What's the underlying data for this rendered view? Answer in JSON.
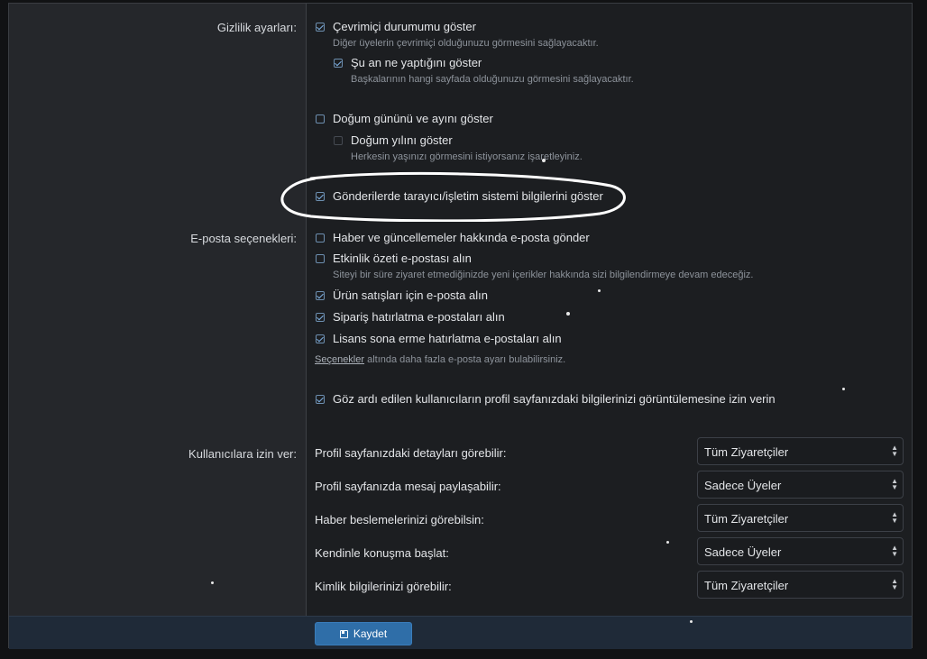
{
  "privacy": {
    "section_label": "Gizlilik ayarları:",
    "show_online": "Çevrimiçi durumumu göster",
    "show_online_hint": "Diğer üyelerin çevrimiçi olduğunuzu görmesini sağlayacaktır.",
    "show_activity": "Şu an ne yaptığını göster",
    "show_activity_hint": "Başkalarının hangi sayfada olduğunuzu görmesini sağlayacaktır.",
    "show_dob_day_month": "Doğum gününü ve ayını göster",
    "show_dob_year": "Doğum yılını göster",
    "show_dob_year_hint": "Herkesin yaşınızı görmesini istiyorsanız işaretleyiniz.",
    "show_browser_os": "Gönderilerde tarayıcı/işletim sistemi bilgilerini göster"
  },
  "email": {
    "section_label": "E-posta seçenekleri:",
    "news": "Haber ve güncellemeler hakkında e-posta gönder",
    "activity_summary": "Etkinlik özeti e-postası alın",
    "activity_summary_hint": "Siteyi bir süre ziyaret etmediğinizde yeni içerikler hakkında sizi bilgilendirmeye devam edeceğiz.",
    "product_sales": "Ürün satışları için e-posta alın",
    "order_reminder": "Sipariş hatırlatma e-postaları alın",
    "license_expiry": "Lisans sona erme hatırlatma e-postaları alın",
    "options_link": "Seçenekler",
    "options_hint_rest": " altında daha fazla e-posta ayarı bulabilirsiniz."
  },
  "ignored_users": "Göz ardı edilen kullanıcıların profil sayfanızdaki bilgilerinizi görüntülemesine izin verin",
  "permissions": {
    "section_label": "Kullanıcılara izin ver:",
    "rows": [
      {
        "label": "Profil sayfanızdaki detayları görebilir:",
        "value": "Tüm Ziyaretçiler"
      },
      {
        "label": "Profil sayfanızda mesaj paylaşabilir:",
        "value": "Sadece Üyeler"
      },
      {
        "label": "Haber beslemelerinizi görebilsin:",
        "value": "Tüm Ziyaretçiler"
      },
      {
        "label": "Kendinle konuşma başlat:",
        "value": "Sadece Üyeler"
      },
      {
        "label": "Kimlik bilgilerinizi görebilir:",
        "value": "Tüm Ziyaretçiler"
      }
    ]
  },
  "footer": {
    "save_label": "Kaydet"
  },
  "icons": {
    "checkbox": "checkbox-icon",
    "select_arrows": "select-arrows-icon",
    "save": "save-icon"
  },
  "colors": {
    "accent": "#2f6ea8",
    "background": "#1c1e21",
    "annotation": "#ffffff"
  }
}
